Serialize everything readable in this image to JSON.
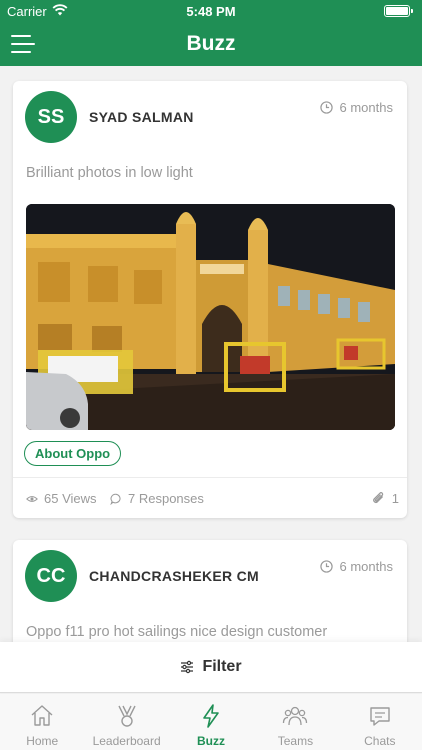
{
  "status_bar": {
    "carrier": "Carrier",
    "time": "5:48 PM"
  },
  "nav": {
    "title": "Buzz",
    "menu_icon": "menu-icon"
  },
  "posts": [
    {
      "avatar_initials": "SS",
      "author": "SYAD SALMAN",
      "posted_ago": "6 months",
      "text": "Brilliant photos in low light",
      "tag": "About Oppo",
      "views": "65 Views",
      "responses": "7 Responses",
      "attachments": "1"
    },
    {
      "avatar_initials": "CC",
      "author": "CHANDCRASHEKER CM",
      "posted_ago": "6 months",
      "text": "Oppo f11 pro hot sailings  nice design customer"
    }
  ],
  "filter": {
    "label": "Filter"
  },
  "tabs": [
    {
      "label": "Home",
      "icon": "home-icon"
    },
    {
      "label": "Leaderboard",
      "icon": "medal-icon"
    },
    {
      "label": "Buzz",
      "icon": "lightning-icon",
      "active": true
    },
    {
      "label": "Teams",
      "icon": "team-icon"
    },
    {
      "label": "Chats",
      "icon": "chat-icon"
    }
  ],
  "colors": {
    "brand": "#1f8f55",
    "muted": "#9a9a9a",
    "background": "#f2f2f2"
  }
}
